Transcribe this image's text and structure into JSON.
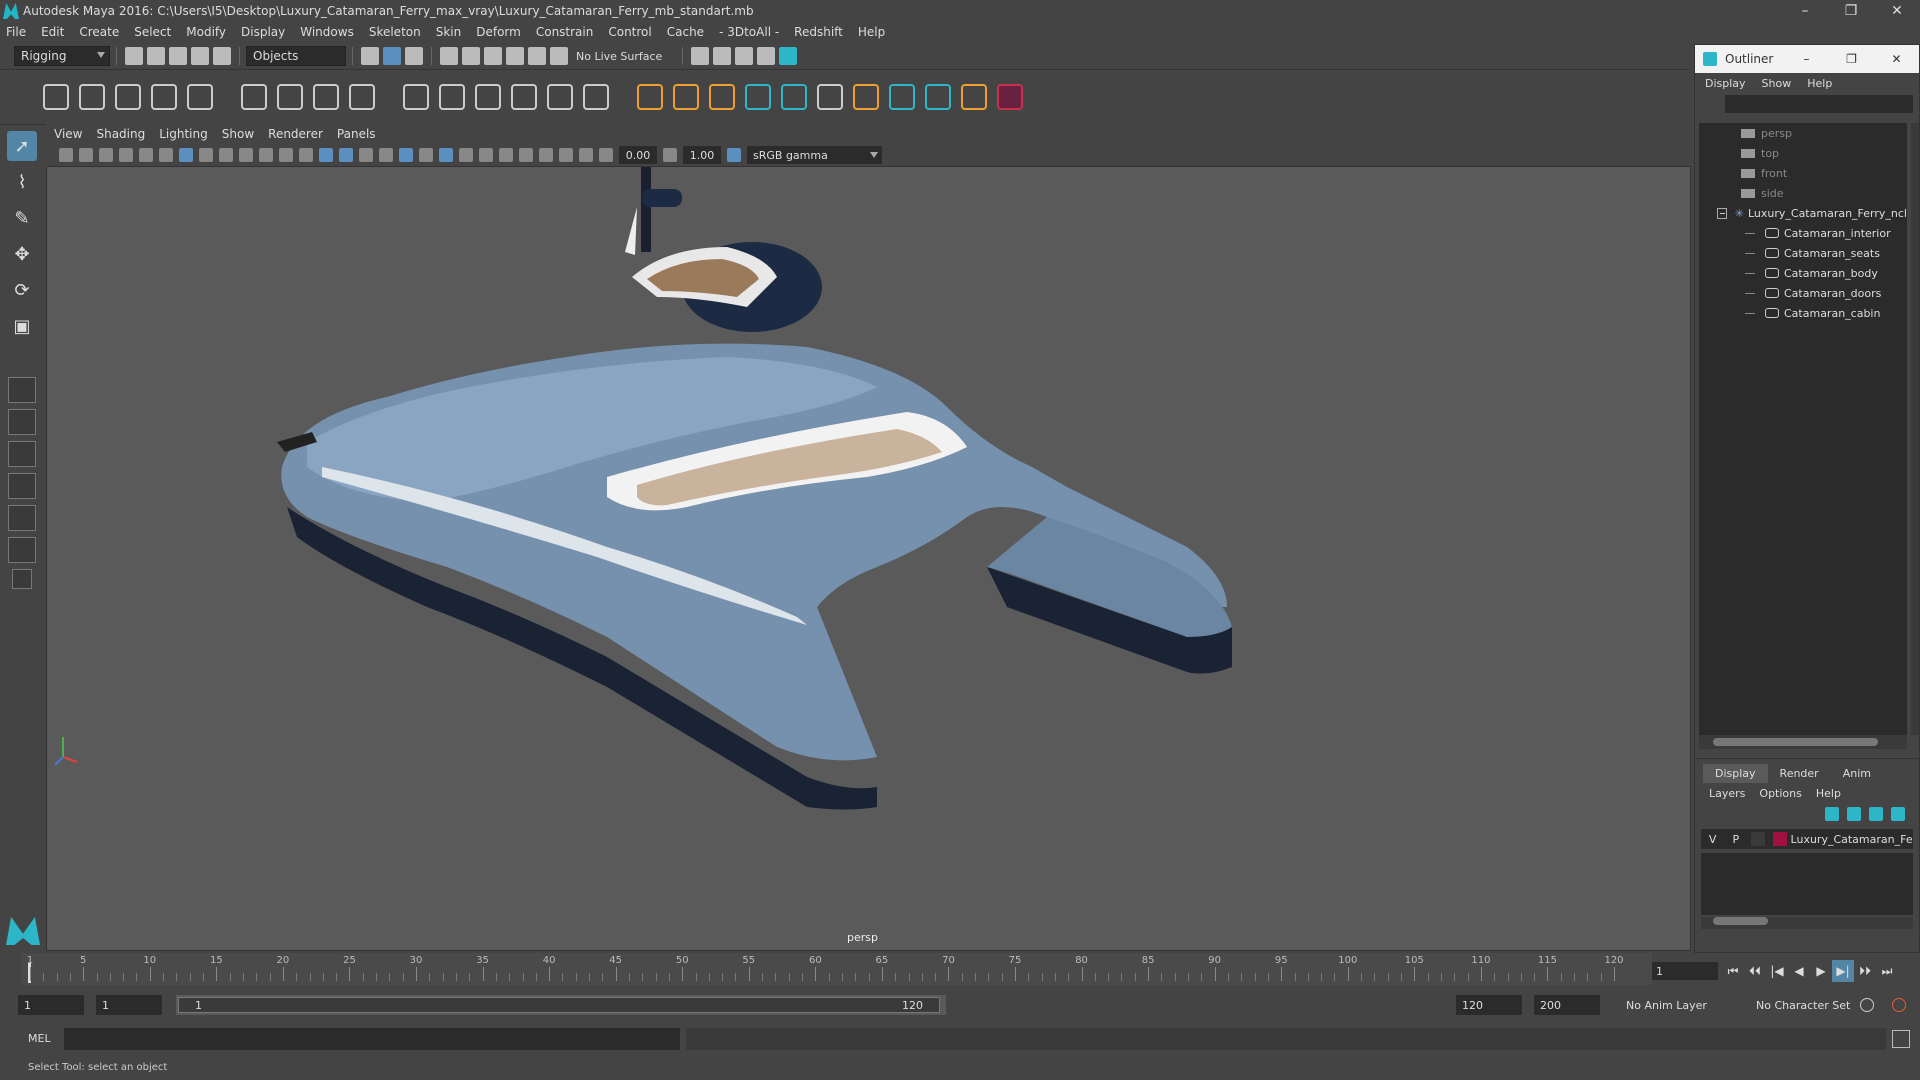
{
  "window": {
    "title": "Autodesk Maya 2016: C:\\Users\\I5\\Desktop\\Luxury_Catamaran_Ferry_max_vray\\Luxury_Catamaran_Ferry_mb_standart.mb",
    "minimize": "–",
    "restore": "❐",
    "close": "✕"
  },
  "menubar": [
    "File",
    "Edit",
    "Create",
    "Select",
    "Modify",
    "Display",
    "Windows",
    "Skeleton",
    "Skin",
    "Deform",
    "Constrain",
    "Control",
    "Cache",
    "- 3DtoAll -",
    "Redshift",
    "Help"
  ],
  "statusline": {
    "menu_set": "Rigging",
    "selection_mode": "Objects",
    "live_surface": "No Live Surface"
  },
  "viewport": {
    "menu": [
      "View",
      "Shading",
      "Lighting",
      "Show",
      "Renderer",
      "Panels"
    ],
    "exposure": "0.00",
    "gamma_value": "1.00",
    "color_space": "sRGB gamma",
    "camera_label": "persp"
  },
  "outliner": {
    "title": "Outliner",
    "menu": [
      "Display",
      "Show",
      "Help"
    ],
    "cameras": [
      "persp",
      "top",
      "front",
      "side"
    ],
    "group": "Luxury_Catamaran_Ferry_ncl",
    "children": [
      "Catamaran_interior",
      "Catamaran_seats",
      "Catamaran_body",
      "Catamaran_doors",
      "Catamaran_cabin"
    ]
  },
  "layer_editor": {
    "tabs": [
      "Display",
      "Render",
      "Anim"
    ],
    "active_tab": "Display",
    "menu": [
      "Layers",
      "Options",
      "Help"
    ],
    "layer": {
      "v": "V",
      "p": "P",
      "name": "Luxury_Catamaran_Fer",
      "color": "#a01040"
    }
  },
  "timeline": {
    "labels": [
      "1",
      "5",
      "10",
      "15",
      "20",
      "25",
      "30",
      "35",
      "40",
      "45",
      "50",
      "55",
      "60",
      "65",
      "70",
      "75",
      "80",
      "85",
      "90",
      "95",
      "100",
      "105",
      "110",
      "115",
      "120"
    ],
    "current_frame": "1",
    "playback_controls": [
      "⏮",
      "⏴⏴",
      "|◀",
      "◀",
      "▶",
      "▶|",
      "⏵⏵",
      "⏭"
    ]
  },
  "range": {
    "start": "1",
    "start_inner": "1",
    "slider_start": "1",
    "slider_end": "120",
    "end_inner": "120",
    "end": "200",
    "anim_layer": "No Anim Layer",
    "character_set": "No Character Set"
  },
  "command": {
    "mel_label": "MEL"
  },
  "help_line": "Select Tool: select an object"
}
